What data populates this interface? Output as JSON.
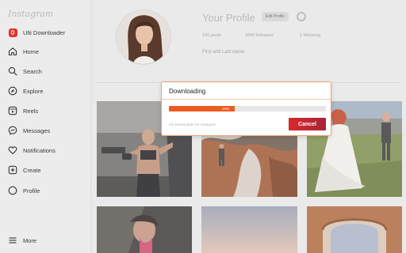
{
  "sidebar": {
    "logo": "Instagram",
    "extension_label": "Ulti Downloader",
    "items": [
      {
        "label": "Home",
        "icon": "home-icon"
      },
      {
        "label": "Search",
        "icon": "search-icon"
      },
      {
        "label": "Explore",
        "icon": "compass-icon"
      },
      {
        "label": "Reels",
        "icon": "reels-icon"
      },
      {
        "label": "Messages",
        "icon": "messenger-icon"
      },
      {
        "label": "Notifications",
        "icon": "heart-icon"
      },
      {
        "label": "Create",
        "icon": "plus-square-icon"
      },
      {
        "label": "Profile",
        "icon": "profile-icon"
      }
    ],
    "more_label": "More"
  },
  "profile": {
    "name": "Your Profile",
    "edit_button": "Edit Profile",
    "posts": "100 posts",
    "followers": "1000 followers",
    "following": "1 following",
    "full_name": "First and Last name"
  },
  "dialog": {
    "title": "Downloading",
    "progress_percent": 42,
    "progress_label": "42%",
    "footer": "Ulti Downloader for Instagram",
    "cancel_label": "Cancel"
  },
  "colors": {
    "accent": "#ec5b1f",
    "cancel_gradient_start": "#d62a2a",
    "cancel_gradient_end": "#a8243a",
    "extension_badge": "#e0352b"
  }
}
